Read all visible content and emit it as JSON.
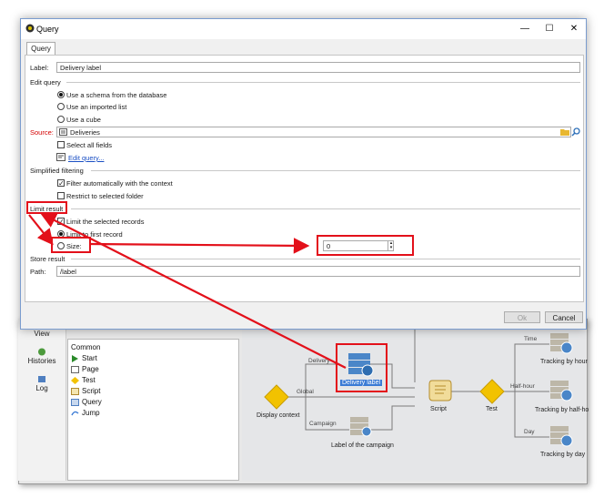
{
  "window": {
    "title": "Query",
    "minimize": "—",
    "maximize": "☐",
    "close": "✕"
  },
  "tab": {
    "label": "Query"
  },
  "label_field": {
    "label": "Label:",
    "value": "Delivery label"
  },
  "edit_query": {
    "heading": "Edit query",
    "options": [
      "Use a schema from the database",
      "Use an imported list",
      "Use a cube"
    ],
    "selected": 0
  },
  "source": {
    "label": "Source:",
    "value": "Deliveries",
    "select_all": "Select all fields",
    "edit_link": "Edit query..."
  },
  "simplified": {
    "heading": "Simplified filtering",
    "auto_filter": "Filter automatically with the context",
    "restrict": "Restrict to selected folder"
  },
  "limit": {
    "heading": "Limit result",
    "limit_selected": "Limit the selected records",
    "first_record": "Limit to first record",
    "size_label": "Size:",
    "size_value": "0"
  },
  "store": {
    "heading": "Store result",
    "path_label": "Path:",
    "path_value": "/label"
  },
  "buttons": {
    "ok": "Ok",
    "cancel": "Cancel"
  },
  "leftnav": {
    "view": "View",
    "histories": "Histories",
    "log": "Log"
  },
  "palette": {
    "items": [
      "Common",
      "Start",
      "Page",
      "Test",
      "Script",
      "Query",
      "Jump"
    ]
  },
  "workflow": {
    "nodes": {
      "delivery_label": "Delivery label",
      "display_context": "Display context",
      "campaign_label": "Label of the campaign",
      "script": "Script",
      "test": "Test",
      "track_hour": "Tracking by hour",
      "track_half": "Tracking by half-ho",
      "track_day": "Tracking by day"
    },
    "edges": {
      "delivery": "Delivery",
      "global": "Global",
      "campaign": "Campaign",
      "time": "Time",
      "half_hour": "Half-hour",
      "day": "Day"
    }
  },
  "colors": {
    "annotation": "#e3101a",
    "accent": "#3a7bd5",
    "required_label": "#d40000"
  }
}
